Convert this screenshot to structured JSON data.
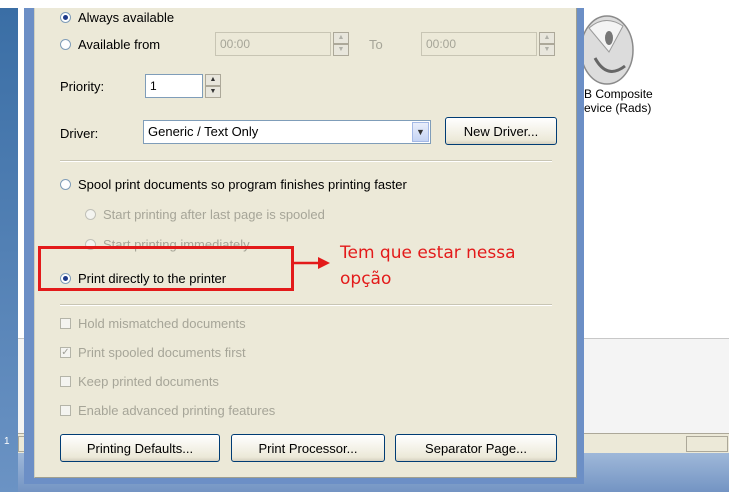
{
  "header_fragments": [
    "...",
    "...",
    "..."
  ],
  "background": {
    "device_label": "B Composite\nevice (Rads)",
    "left_strip_label": "1"
  },
  "dialog": {
    "availability": {
      "always_label": "Always available",
      "from_label": "Available from",
      "from_value": "00:00",
      "to_label": "To",
      "to_value": "00:00"
    },
    "priority": {
      "label": "Priority:",
      "value": "1"
    },
    "driver": {
      "label": "Driver:",
      "value": "Generic / Text Only",
      "new_driver_button": "New Driver..."
    },
    "spool": {
      "spool_label": "Spool print documents so program finishes printing faster",
      "after_last_page_label": "Start printing after last page is spooled",
      "immediately_label": "Start printing immediately",
      "direct_label": "Print directly to the printer"
    },
    "options": {
      "hold_mismatched": "Hold mismatched documents",
      "print_spooled_first": "Print spooled documents first",
      "keep_printed": "Keep printed documents",
      "advanced_features": "Enable advanced printing features"
    },
    "buttons": {
      "printing_defaults": "Printing Defaults...",
      "print_processor": "Print Processor...",
      "separator_page": "Separator Page..."
    }
  },
  "annotation": {
    "text": "Tem que estar nessa\nopção",
    "color": "#e31a1a"
  },
  "colors": {
    "dialog_face": "#ece9d8",
    "frame_blue": "#6c8fc6",
    "disabled_text": "#a6a598"
  }
}
